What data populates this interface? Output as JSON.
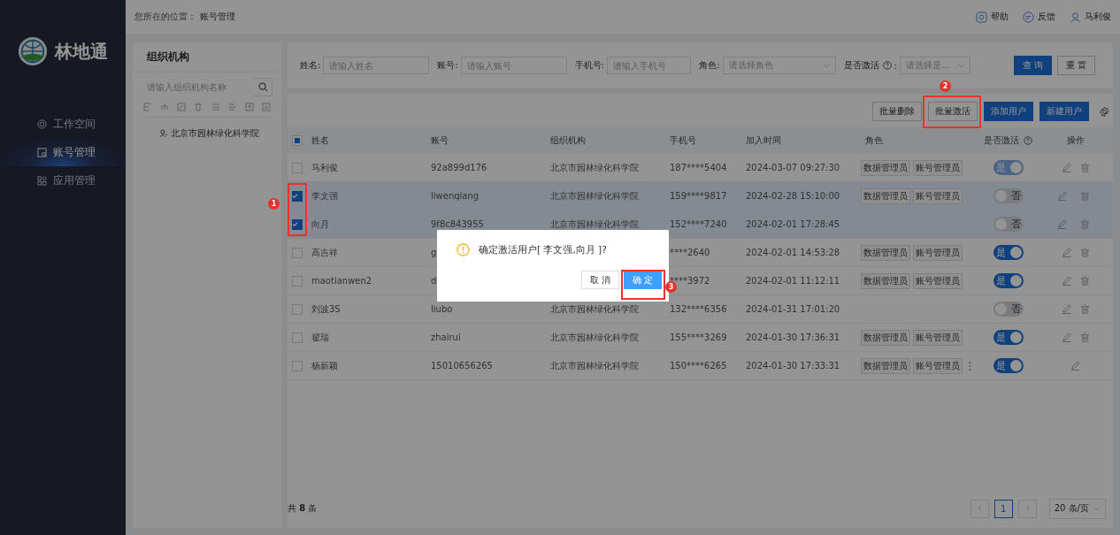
{
  "sidebar": {
    "logo_text": "林地通",
    "items": [
      {
        "label": "工作空间",
        "selected": false
      },
      {
        "label": "账号管理",
        "selected": true
      },
      {
        "label": "应用管理",
        "selected": false
      }
    ]
  },
  "topbar": {
    "breadcrumb_label": "您所在的位置：",
    "breadcrumb_current": "账号管理",
    "links": [
      "帮助",
      "反馈"
    ],
    "user": "马利俊"
  },
  "org_panel": {
    "title": "组织机构",
    "search": {
      "placeholder": "请输入组织机构名称"
    },
    "tree": [
      {
        "label": "北京市园林绿化科学院"
      }
    ]
  },
  "filters": [
    {
      "label": "姓名:",
      "placeholder": "请输入姓名",
      "kind": "input",
      "help": false
    },
    {
      "label": "账号:",
      "placeholder": "请输入账号",
      "kind": "input",
      "help": false
    },
    {
      "label": "手机号:",
      "placeholder": "请输入手机号",
      "kind": "input",
      "help": false
    },
    {
      "label": "角色:",
      "placeholder": "请选择角色",
      "kind": "select",
      "help": false
    },
    {
      "label": "是否激活",
      "suffix": ":",
      "placeholder": "请选择是...",
      "kind": "select",
      "help": true
    }
  ],
  "filter_buttons": [
    {
      "label": "查 询",
      "primary": true
    },
    {
      "label": "重 置",
      "primary": false
    }
  ],
  "toolbar": [
    {
      "label": "批量删除",
      "primary": false
    },
    {
      "label": "批量激活",
      "primary": false
    },
    {
      "label": "添加用户",
      "primary": true
    },
    {
      "label": "新建用户",
      "primary": true
    }
  ],
  "table": {
    "indeterminate": true,
    "columns": [
      {
        "label": "姓名",
        "help": false
      },
      {
        "label": "账号",
        "help": false
      },
      {
        "label": "组织机构",
        "help": false
      },
      {
        "label": "手机号",
        "help": false
      },
      {
        "label": "加入时间",
        "help": false
      },
      {
        "label": "角色",
        "help": false
      },
      {
        "label": "是否激活",
        "help": true
      },
      {
        "label": "操作",
        "help": false
      }
    ],
    "rows": [
      {
        "checked": false,
        "name": "马利俊",
        "account": "92a899d176",
        "org": "北京市园林绿化科学院",
        "phone": "187****5404",
        "joined": "2024-03-07 09:27:30",
        "roles": [
          "数据管理员",
          "账号管理员"
        ],
        "more_roles": false,
        "active": true,
        "active_label": "是",
        "toggle_disabled": true,
        "deletable": true
      },
      {
        "checked": true,
        "name": "李文强",
        "account": "liwenqiang",
        "org": "北京市园林绿化科学院",
        "phone": "159****9817",
        "joined": "2024-02-28 15:10:00",
        "roles": [
          "数据管理员",
          "账号管理员"
        ],
        "more_roles": false,
        "active": false,
        "active_label": "否",
        "toggle_disabled": false,
        "deletable": true
      },
      {
        "checked": true,
        "name": "向月",
        "account": "9f8c843955",
        "org": "北京市园林绿化科学院",
        "phone": "152****7240",
        "joined": "2024-02-01 17:28:45",
        "roles": [],
        "more_roles": false,
        "active": false,
        "active_label": "否",
        "toggle_disabled": false,
        "deletable": true
      },
      {
        "checked": false,
        "name": "高吉祥",
        "account": "g",
        "phone": "****2640",
        "joined": "2024-02-01 14:53:28",
        "roles": [
          "数据管理员",
          "账号管理员"
        ],
        "more_roles": false,
        "active": true,
        "active_label": "是",
        "toggle_disabled": false,
        "deletable": true
      },
      {
        "checked": false,
        "name": "maotianwen2",
        "account": "d",
        "phone": "****3972",
        "joined": "2024-02-01 11:12:11",
        "roles": [
          "数据管理员",
          "账号管理员"
        ],
        "more_roles": false,
        "active": true,
        "active_label": "是",
        "toggle_disabled": false,
        "deletable": true
      },
      {
        "checked": false,
        "name": "刘波3S",
        "account": "liubo",
        "org": "北京市园林绿化科学院",
        "phone": "132****6356",
        "joined": "2024-01-31 17:01:20",
        "roles": [],
        "more_roles": false,
        "active": false,
        "active_label": "否",
        "toggle_disabled": false,
        "deletable": true
      },
      {
        "checked": false,
        "name": "翟瑞",
        "account": "zhairui",
        "org": "北京市园林绿化科学院",
        "phone": "155****3269",
        "joined": "2024-01-30 17:36:31",
        "roles": [
          "数据管理员",
          "账号管理员"
        ],
        "more_roles": false,
        "active": true,
        "active_label": "是",
        "toggle_disabled": false,
        "deletable": true
      },
      {
        "checked": false,
        "name": "杨新颖",
        "account": "15010656265",
        "org": "北京市园林绿化科学院",
        "phone": "150****6265",
        "joined": "2024-01-30 17:33:31",
        "roles": [
          "数据管理员",
          "账号管理员"
        ],
        "more_roles": true,
        "active": true,
        "active_label": "是",
        "toggle_disabled": false,
        "deletable": false
      }
    ]
  },
  "footer": {
    "total": "共 **8** 条",
    "page": "1",
    "page_size": "20 条/页"
  },
  "dialog": {
    "message": "确定激活用户[ 李文强,向月 ]?",
    "buttons": [
      {
        "label": "取 消",
        "primary": false
      },
      {
        "label": "确 定",
        "primary": true
      }
    ]
  },
  "annotations": [
    {
      "label": "1"
    },
    {
      "label": "2"
    },
    {
      "label": "3"
    }
  ]
}
